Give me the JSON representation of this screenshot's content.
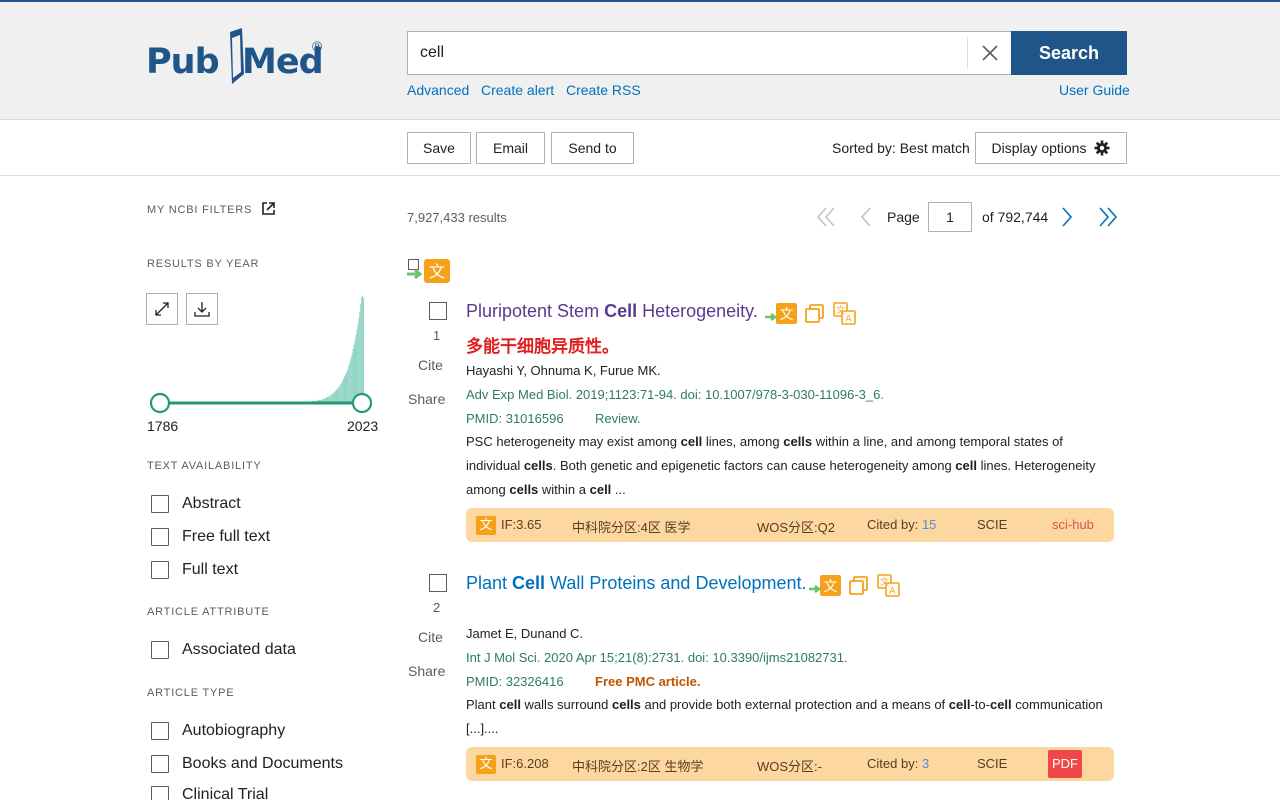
{
  "header": {
    "logo_pub": "Pub",
    "logo_med": "Med",
    "logo_reg": "®",
    "search_value": "cell",
    "search_button": "Search",
    "links": {
      "advanced": "Advanced",
      "create_alert": "Create alert",
      "create_rss": "Create RSS",
      "user_guide": "User Guide"
    }
  },
  "toolbar": {
    "save": "Save",
    "email": "Email",
    "send_to": "Send to",
    "sorted_by": "Sorted by: Best match",
    "display_options": "Display options"
  },
  "sidebar": {
    "my_ncbi_filters": "MY NCBI FILTERS",
    "results_by_year": "RESULTS BY YEAR",
    "year_start": "1786",
    "year_end": "2023",
    "text_availability": {
      "title": "TEXT AVAILABILITY",
      "items": [
        "Abstract",
        "Free full text",
        "Full text"
      ]
    },
    "article_attribute": {
      "title": "ARTICLE ATTRIBUTE",
      "items": [
        "Associated data"
      ]
    },
    "article_type": {
      "title": "ARTICLE TYPE",
      "items": [
        "Autobiography",
        "Books and Documents",
        "Clinical Trial"
      ]
    }
  },
  "results": {
    "count": "7,927,433 results",
    "page_label": "Page",
    "page_value": "1",
    "of_pages": "of 792,744",
    "items": [
      {
        "number": "1",
        "cite": "Cite",
        "share": "Share",
        "title_pre": "Pluripotent Stem ",
        "title_hl": "Cell",
        "title_post": " Heterogeneity.",
        "translated_title": "多能干细胞异质性。",
        "authors": "Hayashi Y, Ohnuma K, Furue MK.",
        "journal": "Adv Exp Med Biol. 2019;1123:71-94. doi: 10.1007/978-3-030-11096-3_6.",
        "pmid": "PMID: 31016596",
        "pub_type": "Review.",
        "snippet": [
          {
            "t": "PSC heterogeneity may exist among ",
            "b": false
          },
          {
            "t": "cell",
            "b": true
          },
          {
            "t": " lines, among ",
            "b": false
          },
          {
            "t": "cells",
            "b": true
          },
          {
            "t": " within a line, and among temporal states of individual ",
            "b": false
          },
          {
            "t": "cells",
            "b": true
          },
          {
            "t": ". Both genetic and epigenetic factors can cause heterogeneity among ",
            "b": false
          },
          {
            "t": "cell",
            "b": true
          },
          {
            "t": " lines. Heterogeneity among ",
            "b": false
          },
          {
            "t": "cells",
            "b": true
          },
          {
            "t": " within a ",
            "b": false
          },
          {
            "t": "cell",
            "b": true
          },
          {
            "t": " ...",
            "b": false
          }
        ],
        "info": {
          "badge": "文",
          "if": "IF:3.65",
          "cas": "中科院分区:4区 医学",
          "wos": "WOS分区:Q2",
          "cited_label": "Cited by:",
          "cited_value": "15",
          "scie": "SCIE",
          "extra": "sci-hub"
        }
      },
      {
        "number": "2",
        "cite": "Cite",
        "share": "Share",
        "title_pre": "Plant ",
        "title_hl": "Cell",
        "title_post": " Wall Proteins and Development.",
        "authors": "Jamet E, Dunand C.",
        "journal": "Int J Mol Sci. 2020 Apr 15;21(8):2731. doi: 10.3390/ijms21082731.",
        "pmid": "PMID: 32326416",
        "free_pmc": "Free PMC article.",
        "snippet": [
          {
            "t": "Plant ",
            "b": false
          },
          {
            "t": "cell",
            "b": true
          },
          {
            "t": " walls surround ",
            "b": false
          },
          {
            "t": "cells",
            "b": true
          },
          {
            "t": " and provide both external protection and a means of ",
            "b": false
          },
          {
            "t": "cell",
            "b": true
          },
          {
            "t": "-to-",
            "b": false
          },
          {
            "t": "cell",
            "b": true
          },
          {
            "t": " communication [...]....",
            "b": false
          }
        ],
        "info": {
          "badge": "文",
          "if": "IF:6.208",
          "cas": "中科院分区:2区 生物学",
          "wos": "WOS分区:-",
          "cited_label": "Cited by:",
          "cited_value": "3",
          "scie": "SCIE",
          "extra": "PDF"
        }
      }
    ]
  },
  "colors": {
    "brand": "#20558a",
    "link": "#0071bc",
    "visited": "#5b3990",
    "journal": "#2e7d5b",
    "infobar": "#fcd8a0"
  },
  "year_histogram": [
    0,
    0,
    0,
    0,
    0,
    0,
    0,
    0,
    0,
    0,
    0,
    0,
    0,
    0,
    0,
    0,
    0,
    0,
    0,
    0,
    0,
    0,
    0,
    0,
    0,
    0,
    0,
    0,
    0,
    0,
    0,
    0,
    0,
    0,
    0,
    0,
    0,
    0,
    0,
    0,
    0,
    0,
    0,
    0,
    0,
    0,
    0,
    0,
    0,
    0,
    0,
    0,
    0,
    0,
    0,
    0,
    0,
    0,
    0,
    0,
    0,
    0,
    0,
    0,
    0,
    0,
    0,
    0,
    0,
    0,
    0,
    0,
    0,
    0,
    0,
    0,
    0,
    0,
    0,
    0,
    0,
    0,
    0,
    0,
    0,
    0,
    0,
    0,
    0,
    0,
    0,
    0,
    0,
    0,
    0,
    0,
    0,
    0,
    0,
    0,
    0,
    0,
    0,
    0,
    0,
    0,
    0,
    0,
    0,
    0,
    0,
    0,
    0,
    0,
    0,
    0,
    0,
    0,
    0,
    0,
    0,
    0,
    0,
    0,
    0,
    0,
    0,
    0,
    0,
    0,
    0,
    0,
    0,
    0,
    0,
    0,
    0,
    0,
    0,
    0,
    0,
    0,
    0,
    0,
    0,
    0,
    0,
    0,
    0,
    0,
    0,
    0,
    0,
    0,
    0,
    0,
    0,
    0,
    0,
    0,
    0,
    0,
    1,
    1,
    1,
    1,
    1,
    1,
    2,
    2,
    2,
    2,
    2,
    3,
    3,
    3,
    4,
    4,
    5,
    5,
    6,
    6,
    7,
    8,
    8,
    9,
    10,
    11,
    12,
    13,
    14,
    15,
    17,
    18,
    20,
    22,
    24,
    26,
    28,
    30,
    33,
    36,
    39,
    42,
    46,
    50,
    54,
    58,
    63,
    68,
    73,
    79,
    85,
    92,
    99,
    100,
    98
  ]
}
